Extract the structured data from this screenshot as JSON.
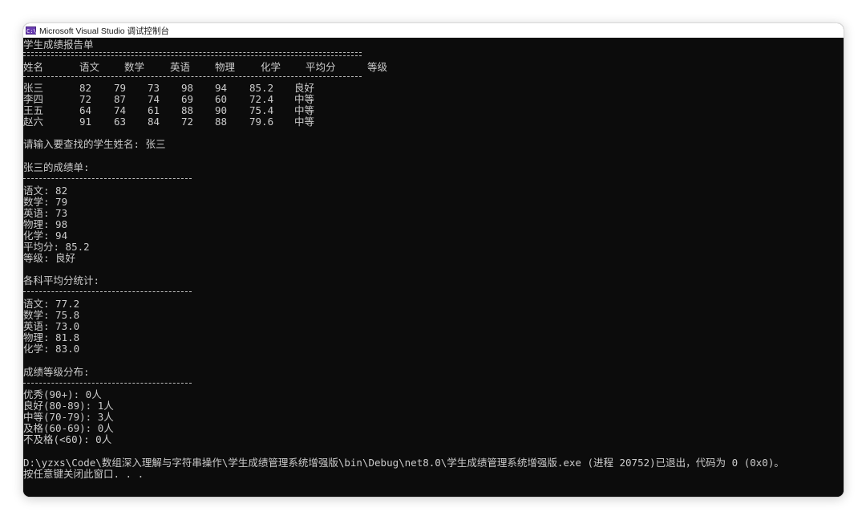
{
  "window": {
    "title": "Microsoft Visual Studio 调试控制台",
    "icon": "console-app-icon",
    "icon_glyph": "C:\\"
  },
  "report": {
    "title": "学生成绩报告单",
    "headers": [
      "姓名",
      "语文",
      "数学",
      "英语",
      "物理",
      "化学",
      "平均分",
      "等级"
    ],
    "students": [
      {
        "name": "张三",
        "chinese": "82",
        "math": "79",
        "english": "73",
        "physics": "98",
        "chemistry": "94",
        "average": "85.2",
        "grade": "良好"
      },
      {
        "name": "李四",
        "chinese": "72",
        "math": "87",
        "english": "74",
        "physics": "69",
        "chemistry": "60",
        "average": "72.4",
        "grade": "中等"
      },
      {
        "name": "王五",
        "chinese": "64",
        "math": "74",
        "english": "61",
        "physics": "88",
        "chemistry": "90",
        "average": "75.4",
        "grade": "中等"
      },
      {
        "name": "赵六",
        "chinese": "91",
        "math": "63",
        "english": "84",
        "physics": "72",
        "chemistry": "88",
        "average": "79.6",
        "grade": "中等"
      }
    ]
  },
  "search": {
    "prompt": "请输入要查找的学生姓名: 张三"
  },
  "detail": {
    "title": "张三的成绩单:",
    "lines": [
      "语文: 82",
      "数学: 79",
      "英语: 73",
      "物理: 98",
      "化学: 94",
      "平均分: 85.2",
      "等级: 良好"
    ]
  },
  "averages": {
    "title": "各科平均分统计:",
    "lines": [
      "语文: 77.2",
      "数学: 75.8",
      "英语: 73.0",
      "物理: 81.8",
      "化学: 83.0"
    ]
  },
  "distribution": {
    "title": "成绩等级分布:",
    "lines": [
      "优秀(90+): 0人",
      "良好(80-89): 1人",
      "中等(70-79): 3人",
      "及格(60-69): 0人",
      "不及格(<60): 0人"
    ]
  },
  "exit": {
    "message": "D:\\yzxs\\Code\\数组深入理解与字符串操作\\学生成绩管理系统增强版\\bin\\Debug\\net8.0\\学生成绩管理系统增强版.exe (进程 20752)已退出，代码为 0 (0x0)。",
    "close_prompt": "按任意键关闭此窗口. . ."
  }
}
